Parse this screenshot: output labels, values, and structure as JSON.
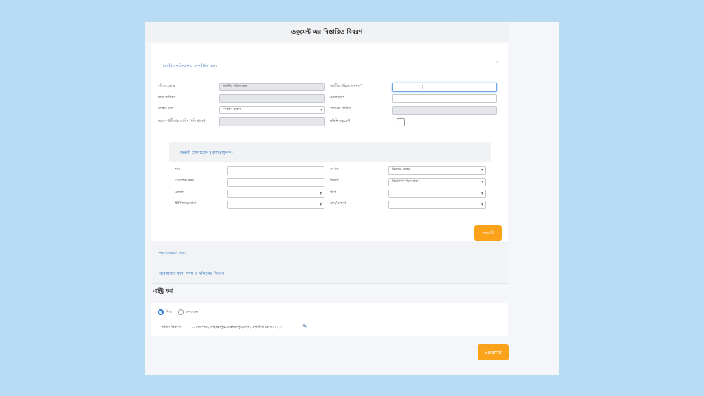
{
  "page": {
    "title": "ডকুমেন্ট এর বিস্তারিত বিবরণ"
  },
  "nid_section": {
    "header": "জাতীয় পরিচয়পত্র সম্পর্কিত তথ্য",
    "fields": {
      "id_type_label": "দলিল প্রকার",
      "id_type_value": "জাতীয় পরিচয়পত্র",
      "nid_no_label": "জাতীয় পরিচয়পত্র নং *",
      "nid_no_value": "",
      "dob_label": "জন্ম তারিখ*",
      "mobile_label": "মোবাইল *",
      "blood_group_label": "রক্তের গ্রুপ",
      "blood_group_value": "নির্বাচন করুন",
      "issue_date_label": "প্রদানের তারিখ",
      "expiry_label": "মেয়াদ উত্তীর্ণের তারিখ (যদি থাকে)",
      "nominee_label": "নমিনি ডকুমেন্ট",
      "nominee_checked": false
    },
    "contact": {
      "header": "জরুরী যোগাযোগ (বাধ্যতামূলক)",
      "name_label": "নাম",
      "relation_label": "সম্পর্ক",
      "relation_value": "নির্বাচন করুন",
      "mobile_label": "মোবাইল নম্বর",
      "division_label": "বিভাগ",
      "division_value": "বিভাগ নির্বাচন করুন",
      "district_label": "জেলা",
      "thana_label": "থানা",
      "union_label": "ইউনিয়ন/ওয়ার্ড",
      "village_label": "গ্রাম/এলাকা"
    },
    "next_button": "পরবর্তী"
  },
  "collapsed_sections": [
    "শনাক্তকরণ তথ্য",
    "ব্যবসায়ের স্থান, সময় ও দলিলের বিবরণ"
  ],
  "entry": {
    "title": "এন্ট্রি ফর্ম",
    "radio_options": [
      "নিজ",
      "অন্য জন"
    ],
    "radio_selected": 0,
    "address_label": "বর্তমান ঠিকানা:",
    "address_value": "...দেওপাড়া,মোহাম্মদপুর,মোহাম্মদপুর,ঢাকা , পোস্টাল কোড: ১২০৭",
    "edit_icon": "edit-icon"
  },
  "submit_button": "Submit",
  "colors": {
    "accent": "#f9a21a",
    "link": "#2a6fb8",
    "background": "#b9dcf5"
  }
}
